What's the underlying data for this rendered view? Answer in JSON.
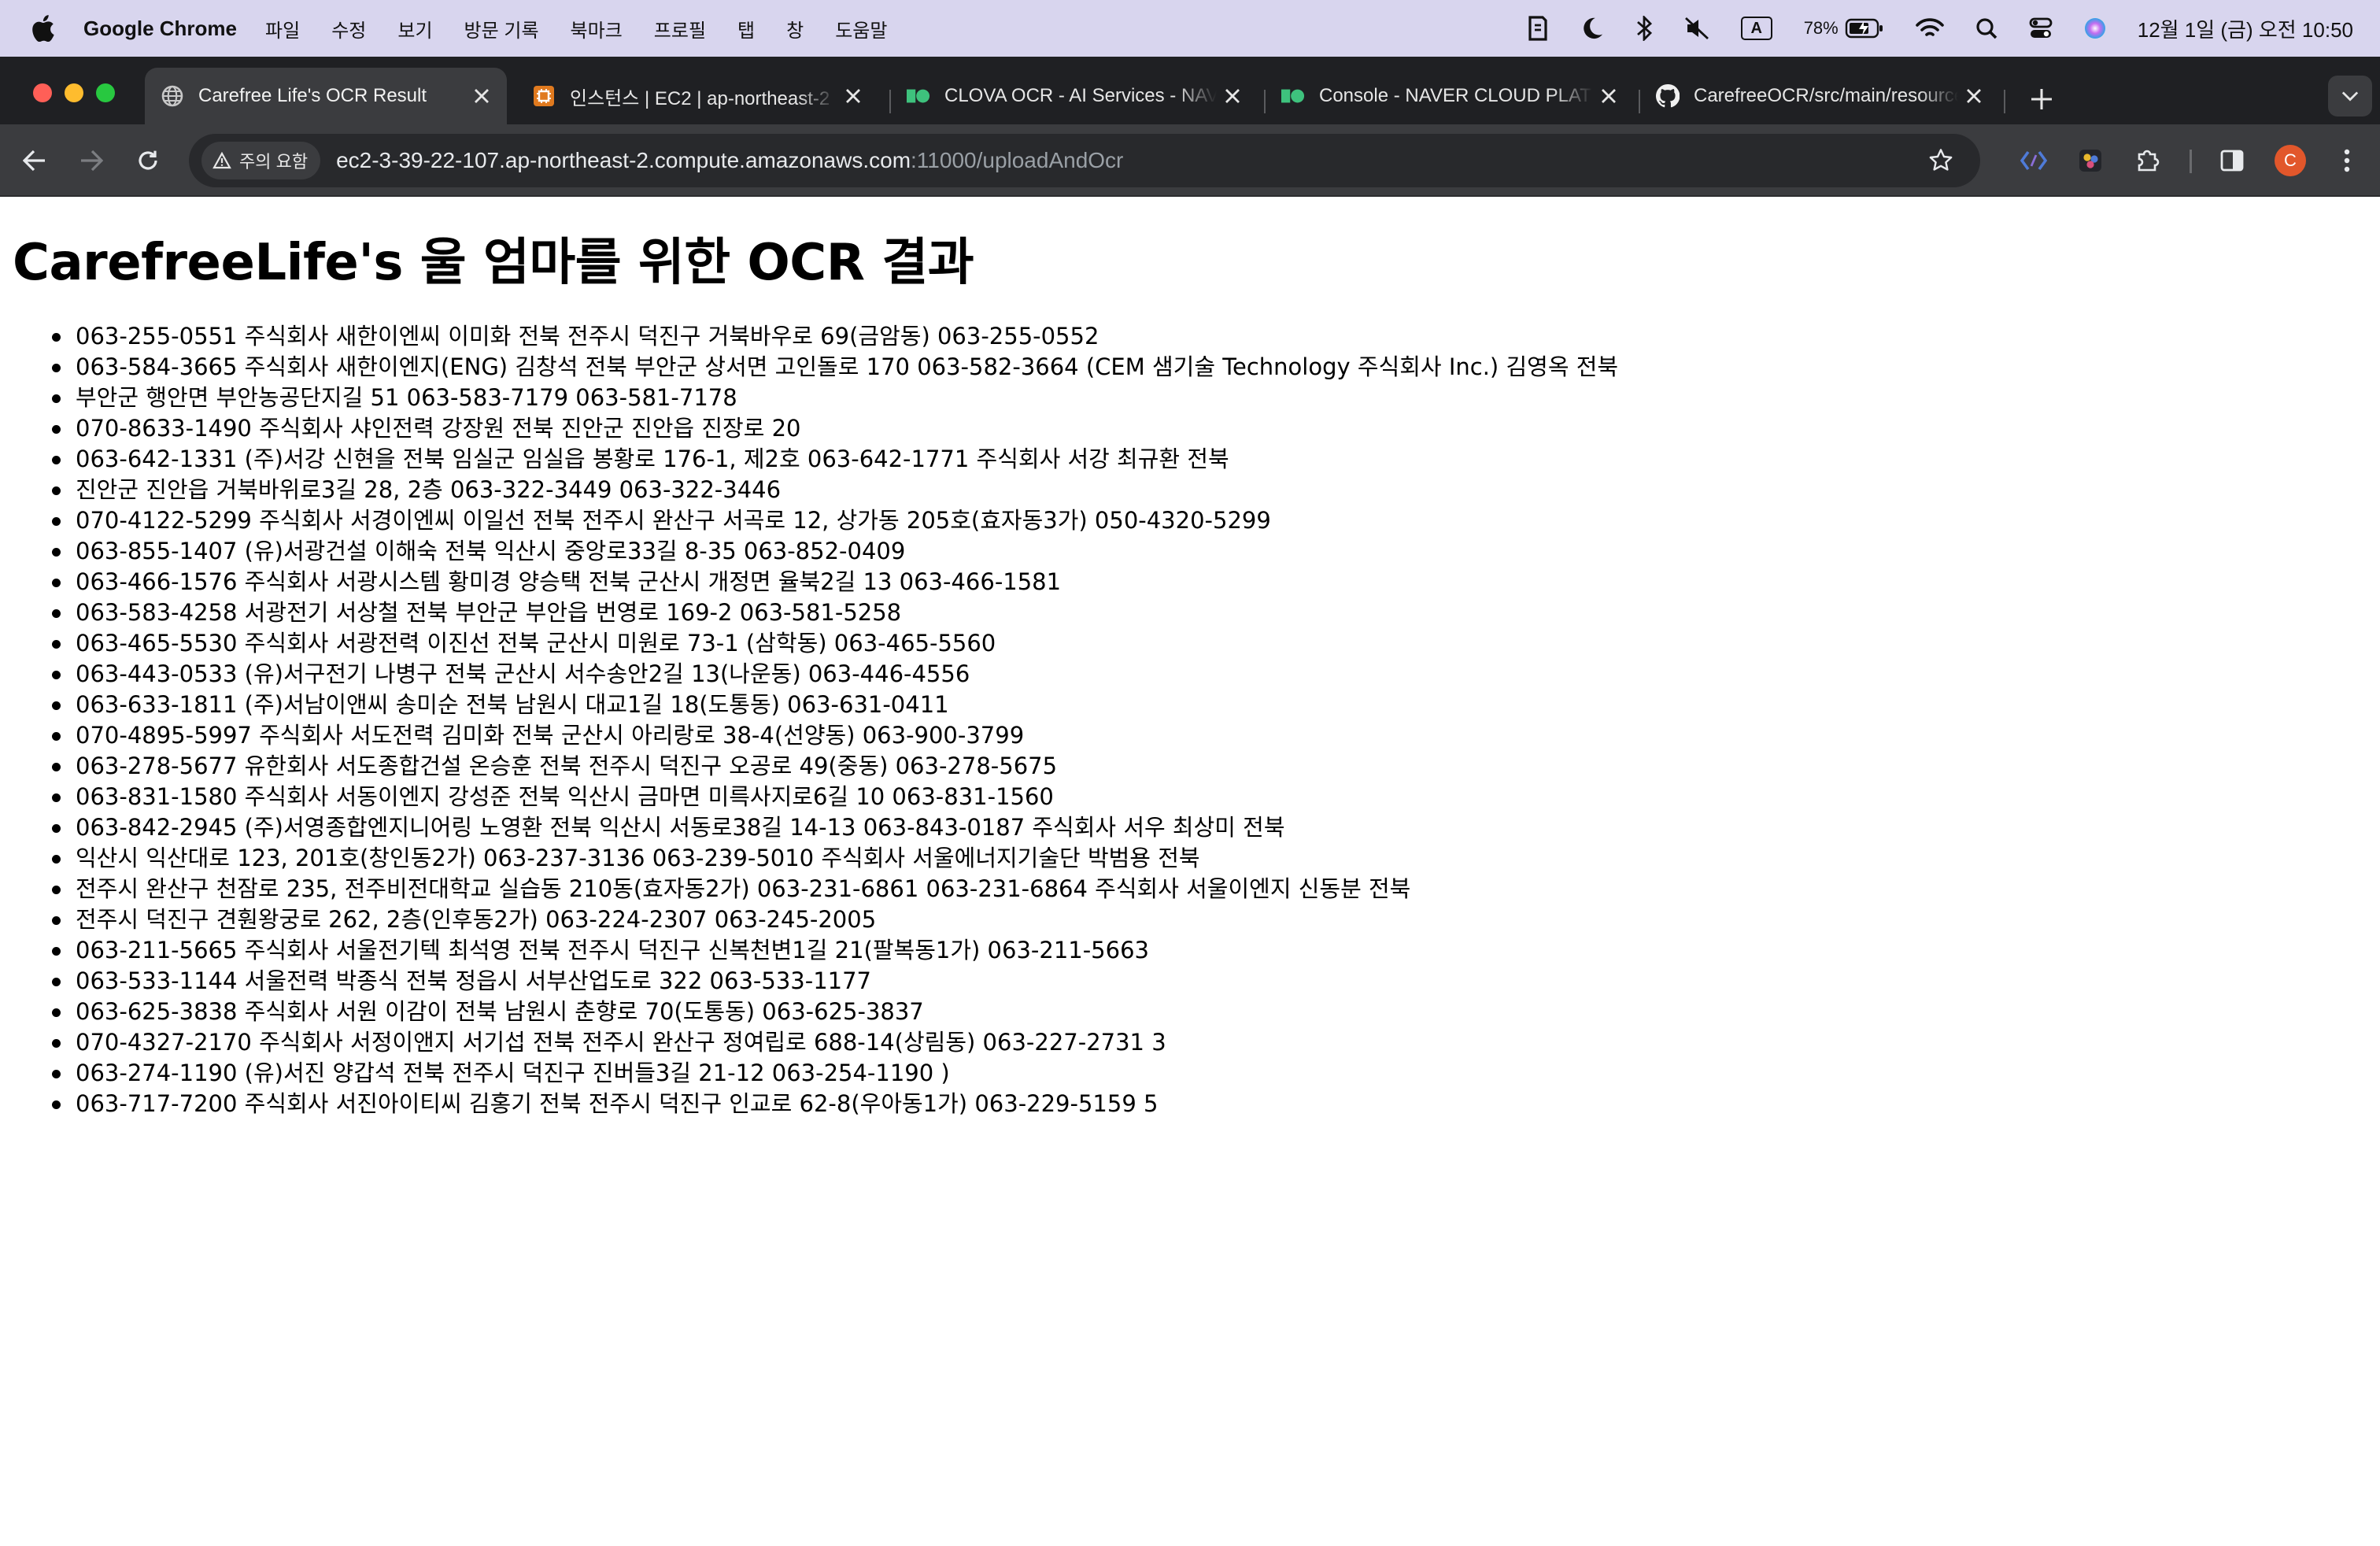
{
  "menubar": {
    "app_name": "Google Chrome",
    "items": [
      "파일",
      "수정",
      "보기",
      "방문 기록",
      "북마크",
      "프로필",
      "탭",
      "창",
      "도움말"
    ],
    "battery_percent": "78%",
    "input_source": "A",
    "clock": "12월 1일 (금) 오전 10:50"
  },
  "tabs": [
    {
      "title": "Carefree Life's OCR Result",
      "icon": "globe-icon",
      "active": true
    },
    {
      "title": "인스턴스 | EC2 | ap-northeast-2",
      "icon": "aws-ec2-icon",
      "active": false
    },
    {
      "title": "CLOVA OCR - AI Services - NAVER",
      "icon": "naver-cloud-icon",
      "active": false
    },
    {
      "title": "Console - NAVER CLOUD PLATFORM",
      "icon": "naver-cloud-icon",
      "active": false
    },
    {
      "title": "CarefreeOCR/src/main/resources",
      "icon": "github-icon",
      "active": false
    }
  ],
  "toolbar": {
    "security_label": "주의 요함",
    "url_host": "ec2-3-39-22-107.ap-northeast-2.compute.amazonaws.com",
    "url_path": ":11000/uploadAndOcr",
    "profile_initial": "C"
  },
  "page": {
    "heading": "CarefreeLife's 울 엄마를 위한 OCR 결과",
    "results": [
      "063-255-0551 주식회사 새한이엔씨 이미화 전북 전주시 덕진구 거북바우로 69(금암동) 063-255-0552",
      "063-584-3665 주식회사 새한이엔지(ENG) 김창석 전북 부안군 상서면 고인돌로 170 063-582-3664 (CEM 샘기술 Technology 주식회사 Inc.) 김영옥 전북",
      "부안군 행안면 부안농공단지길 51 063-583-7179 063-581-7178",
      "070-8633-1490 주식회사 샤인전력 강장원 전북 진안군 진안읍 진장로 20",
      "063-642-1331 (주)서강 신현을 전북 임실군 임실읍 봉황로 176-1, 제2호 063-642-1771 주식회사 서강 최규환 전북",
      "진안군 진안읍 거북바위로3길 28, 2층 063-322-3449 063-322-3446",
      "070-4122-5299 주식회사 서경이엔씨 이일선 전북 전주시 완산구 서곡로 12, 상가동 205호(효자동3가) 050-4320-5299",
      "063-855-1407 (유)서광건설 이해숙 전북 익산시 중앙로33길 8-35 063-852-0409",
      "063-466-1576 주식회사 서광시스템 황미경 양승택 전북 군산시 개정면 율북2길 13 063-466-1581",
      "063-583-4258 서광전기 서상철 전북 부안군 부안읍 번영로 169-2 063-581-5258",
      "063-465-5530 주식회사 서광전력 이진선 전북 군산시 미원로 73-1 (삼학동) 063-465-5560",
      "063-443-0533 (유)서구전기 나병구 전북 군산시 서수송안2길 13(나운동) 063-446-4556",
      "063-633-1811 (주)서남이앤씨 송미순 전북 남원시 대교1길 18(도통동) 063-631-0411",
      "070-4895-5997 주식회사 서도전력 김미화 전북 군산시 아리랑로 38-4(선양동) 063-900-3799",
      "063-278-5677 유한회사 서도종합건설 온승훈 전북 전주시 덕진구 오공로 49(중동) 063-278-5675",
      "063-831-1580 주식회사 서동이엔지 강성준 전북 익산시 금마면 미륵사지로6길 10 063-831-1560",
      "063-842-2945 (주)서영종합엔지니어링 노영환 전북 익산시 서동로38길 14-13 063-843-0187 주식회사 서우 최상미 전북",
      "익산시 익산대로 123, 201호(창인동2가) 063-237-3136 063-239-5010 주식회사 서울에너지기술단 박범용 전북",
      "전주시 완산구 천잠로 235, 전주비전대학교 실습동 210동(효자동2가) 063-231-6861 063-231-6864 주식회사 서울이엔지 신동분 전북",
      "전주시 덕진구 견훤왕궁로 262, 2층(인후동2가) 063-224-2307 063-245-2005",
      "063-211-5665 주식회사 서울전기텍 최석영 전북 전주시 덕진구 신복천변1길 21(팔복동1가) 063-211-5663",
      "063-533-1144 서울전력 박종식 전북 정읍시 서부산업도로 322 063-533-1177",
      "063-625-3838 주식회사 서원 이감이 전북 남원시 춘향로 70(도통동) 063-625-3837",
      "070-4327-2170 주식회사 서정이앤지 서기섭 전북 전주시 완산구 정여립로 688-14(상림동) 063-227-2731 3",
      "063-274-1190 (유)서진 양갑석 전북 전주시 덕진구 진버들3길 21-12 063-254-1190 )",
      "063-717-7200 주식회사 서진아이티씨 김홍기 전북 전주시 덕진구 인교로 62-8(우아동1가) 063-229-5159 5"
    ]
  }
}
